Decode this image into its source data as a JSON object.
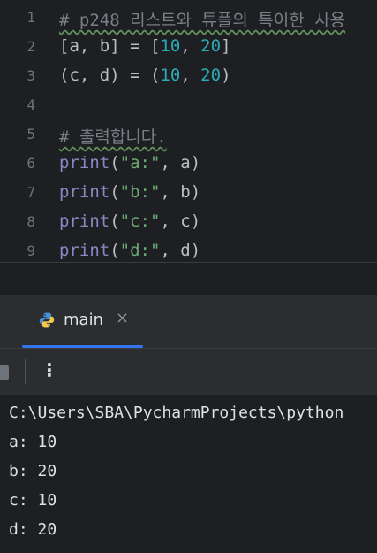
{
  "editor": {
    "line_numbers": [
      "1",
      "2",
      "3",
      "4",
      "5",
      "6",
      "7",
      "8",
      "9"
    ],
    "lines": {
      "l1": "# p248 리스트와 튜플의 특이한 사용",
      "l2a": "[a, b] = [",
      "l2b": "10",
      "l2c": ", ",
      "l2d": "20",
      "l2e": "]",
      "l3a": "(c, d) = (",
      "l3b": "10",
      "l3c": ", ",
      "l3d": "20",
      "l3e": ")",
      "l5": "# 출력합니다.",
      "l6fn": "print",
      "l6a": "(",
      "l6s": "\"a:\"",
      "l6b": ", a)",
      "l7fn": "print",
      "l7a": "(",
      "l7s": "\"b:\"",
      "l7b": ", b)",
      "l8fn": "print",
      "l8a": "(",
      "l8s": "\"c:\"",
      "l8b": ", c)",
      "l9fn": "print",
      "l9a": "(",
      "l9s": "\"d:\"",
      "l9b": ", d)"
    }
  },
  "run_panel": {
    "tab_label": "main",
    "tab_icon": "python-icon",
    "close_symbol": "×",
    "more_symbol": "⋮"
  },
  "console": {
    "lines": [
      "C:\\Users\\SBA\\PycharmProjects\\python",
      "a: 10",
      "b: 20",
      "c: 10",
      "d: 20"
    ]
  },
  "colors": {
    "accent": "#3574f0",
    "number": "#2aacb8",
    "string": "#6aab73",
    "builtin": "#8888c6",
    "comment": "#7a7e85"
  }
}
